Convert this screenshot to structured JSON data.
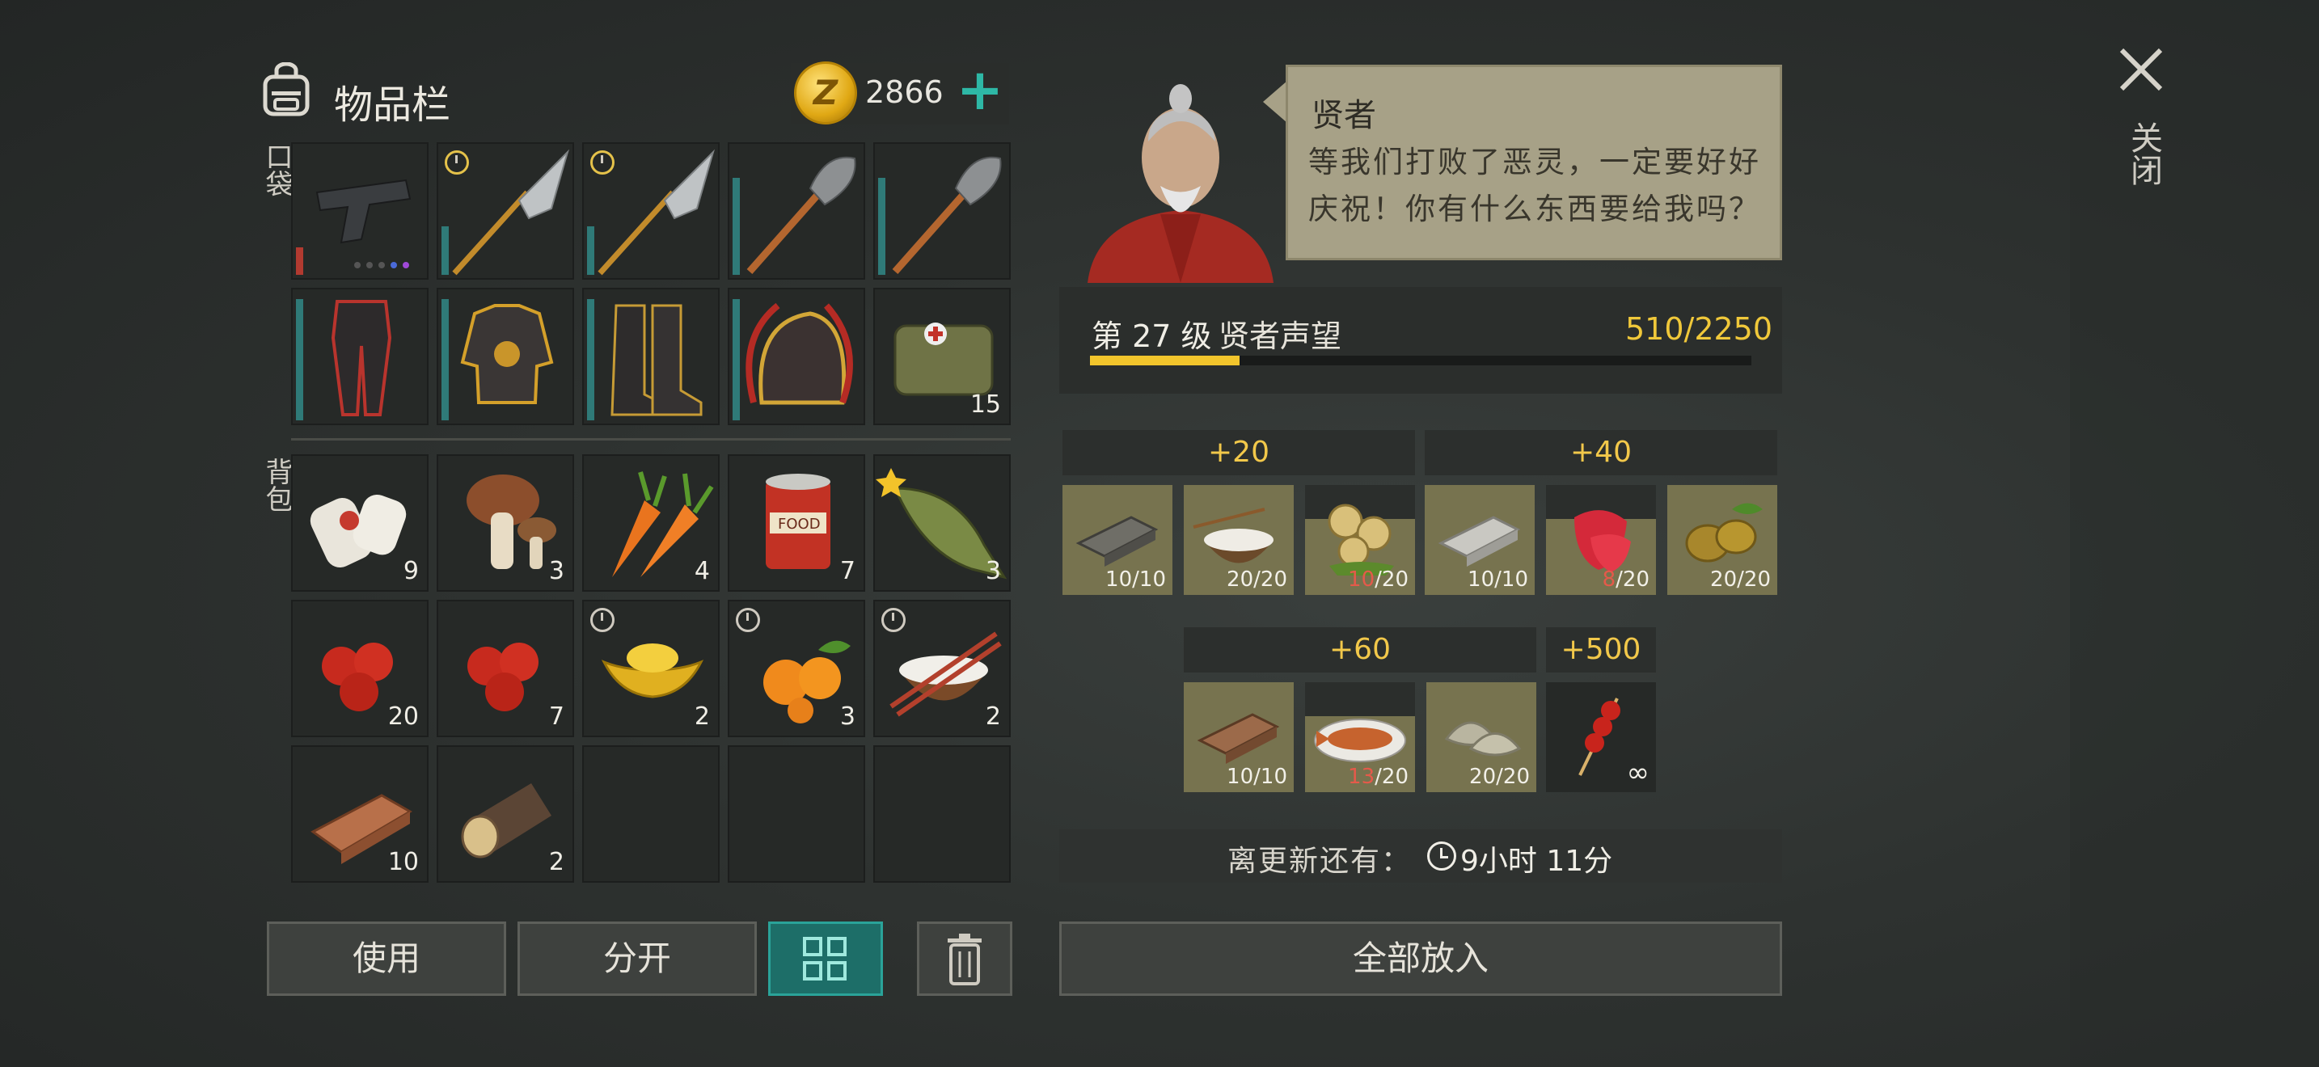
{
  "inventory": {
    "title": "物品栏",
    "coins": "2866",
    "coin_symbol": "Z",
    "pocket_label": "口袋",
    "backpack_label": "背包",
    "equipment": [
      {
        "name": "pistol",
        "count": ""
      },
      {
        "name": "guandao",
        "count": ""
      },
      {
        "name": "guandao",
        "count": ""
      },
      {
        "name": "shovel",
        "count": ""
      },
      {
        "name": "shovel",
        "count": ""
      },
      {
        "name": "pants",
        "count": ""
      },
      {
        "name": "armor",
        "count": ""
      },
      {
        "name": "boots",
        "count": ""
      },
      {
        "name": "helmet",
        "count": ""
      },
      {
        "name": "medkit-bag",
        "count": "15"
      }
    ],
    "backpack": [
      {
        "name": "bandage",
        "count": "9"
      },
      {
        "name": "mushroom",
        "count": "3"
      },
      {
        "name": "carrot",
        "count": "4"
      },
      {
        "name": "canned-food",
        "count": "7"
      },
      {
        "name": "fish",
        "count": "3"
      },
      {
        "name": "apple",
        "count": "20"
      },
      {
        "name": "apple",
        "count": "7"
      },
      {
        "name": "gold-ingot",
        "count": "2"
      },
      {
        "name": "orange",
        "count": "3"
      },
      {
        "name": "rice-bowl",
        "count": "2"
      },
      {
        "name": "copper-ingot",
        "count": "10"
      },
      {
        "name": "log",
        "count": "2"
      },
      {
        "name": "empty",
        "count": ""
      },
      {
        "name": "empty",
        "count": ""
      },
      {
        "name": "empty",
        "count": ""
      }
    ],
    "buttons": {
      "use": "使用",
      "split": "分开",
      "put_all": "全部放入"
    }
  },
  "npc": {
    "name": "贤者",
    "dialogue": "等我们打败了恶灵，一定要好好庆祝！你有什么东西要给我吗？"
  },
  "reputation": {
    "level_text": "第 27 级",
    "name": "贤者声望",
    "value_text": "510/2250",
    "current": 510,
    "max": 2250
  },
  "tiers": [
    {
      "reward": "+20",
      "items": [
        {
          "name": "iron-ingot",
          "cur": "10",
          "max": "10",
          "low": false
        },
        {
          "name": "rice-bowl",
          "cur": "20",
          "max": "20",
          "low": false
        },
        {
          "name": "lotus-root",
          "cur": "10",
          "max": "20",
          "low": true
        }
      ]
    },
    {
      "reward": "+40",
      "items": [
        {
          "name": "silver-ingot",
          "cur": "10",
          "max": "10",
          "low": false
        },
        {
          "name": "strawberry",
          "cur": "8",
          "max": "20",
          "low": true
        },
        {
          "name": "kiwi",
          "cur": "20",
          "max": "20",
          "low": false
        }
      ]
    },
    {
      "reward": "+60",
      "items": [
        {
          "name": "copper-ingot",
          "cur": "10",
          "max": "10",
          "low": false
        },
        {
          "name": "fish-dish",
          "cur": "13",
          "max": "20",
          "low": true
        },
        {
          "name": "dumplings",
          "cur": "20",
          "max": "20",
          "low": false
        }
      ]
    },
    {
      "reward": "+500",
      "items": [
        {
          "name": "tanghulu",
          "cur": "∞",
          "max": "",
          "low": false
        }
      ]
    }
  ],
  "refresh": {
    "label": "离更新还有：",
    "time": "9小时 11分"
  },
  "close_label": "关闭",
  "colors": {
    "accent_teal": "#2eb8a6",
    "gold": "#f2c52c",
    "slot_bg": "#262927",
    "donate_bg": "#77734f"
  }
}
